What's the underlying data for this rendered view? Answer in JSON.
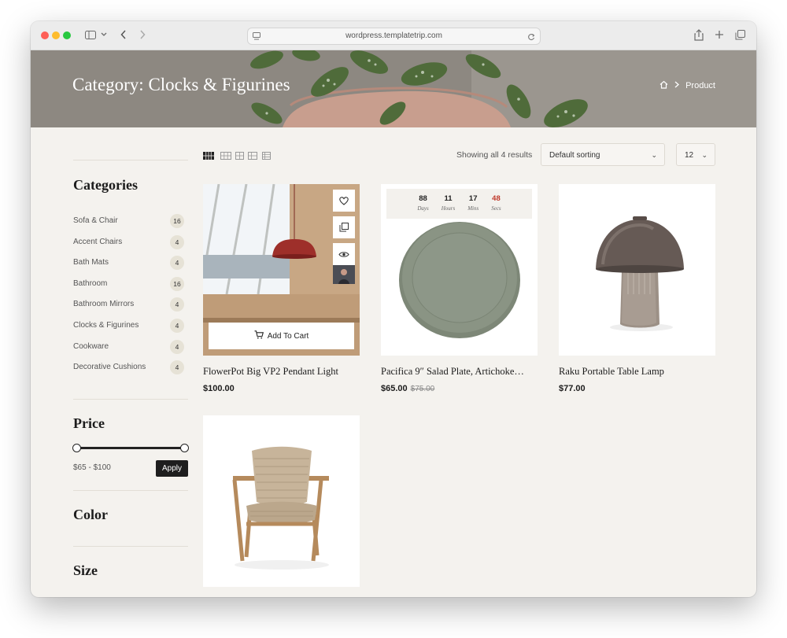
{
  "browser": {
    "url": "wordpress.templatetrip.com"
  },
  "hero": {
    "title": "Category: Clocks & Figurines",
    "breadcrumb_current": "Product"
  },
  "sidebar": {
    "categories_title": "Categories",
    "categories": [
      {
        "label": "Sofa & Chair",
        "count": "16"
      },
      {
        "label": "Accent Chairs",
        "count": "4"
      },
      {
        "label": "Bath Mats",
        "count": "4"
      },
      {
        "label": "Bathroom",
        "count": "16"
      },
      {
        "label": "Bathroom Mirrors",
        "count": "4"
      },
      {
        "label": "Clocks & Figurines",
        "count": "4"
      },
      {
        "label": "Cookware",
        "count": "4"
      },
      {
        "label": "Decorative Cushions",
        "count": "4"
      }
    ],
    "price_title": "Price",
    "price_range": "$65 - $100",
    "apply_label": "Apply",
    "color_title": "Color",
    "size_title": "Size"
  },
  "shop": {
    "results_text": "Showing all 4 results",
    "sorting_value": "Default sorting",
    "per_page_value": "12"
  },
  "products": [
    {
      "name": "FlowerPot Big VP2 Pendant Light",
      "price": "$100.00",
      "add_to_cart": "Add To Cart"
    },
    {
      "name": "Pacifica 9″ Salad Plate, Artichoke…",
      "price": "$65.00",
      "old_price": "$75.00",
      "countdown": {
        "days": "88",
        "hours": "11",
        "mins": "17",
        "secs": "48",
        "days_label": "Days",
        "hours_label": "Hours",
        "mins_label": "Mins",
        "secs_label": "Secs"
      }
    },
    {
      "name": "Raku Portable Table Lamp",
      "price": "$77.00"
    },
    {
      "name": "",
      "price": ""
    }
  ],
  "colors": {
    "page_bg": "#f4f2ee",
    "accent_dark": "#1e1e1e",
    "countdown_secs": "#c0392b",
    "count_badge": "#e6e2d6"
  }
}
